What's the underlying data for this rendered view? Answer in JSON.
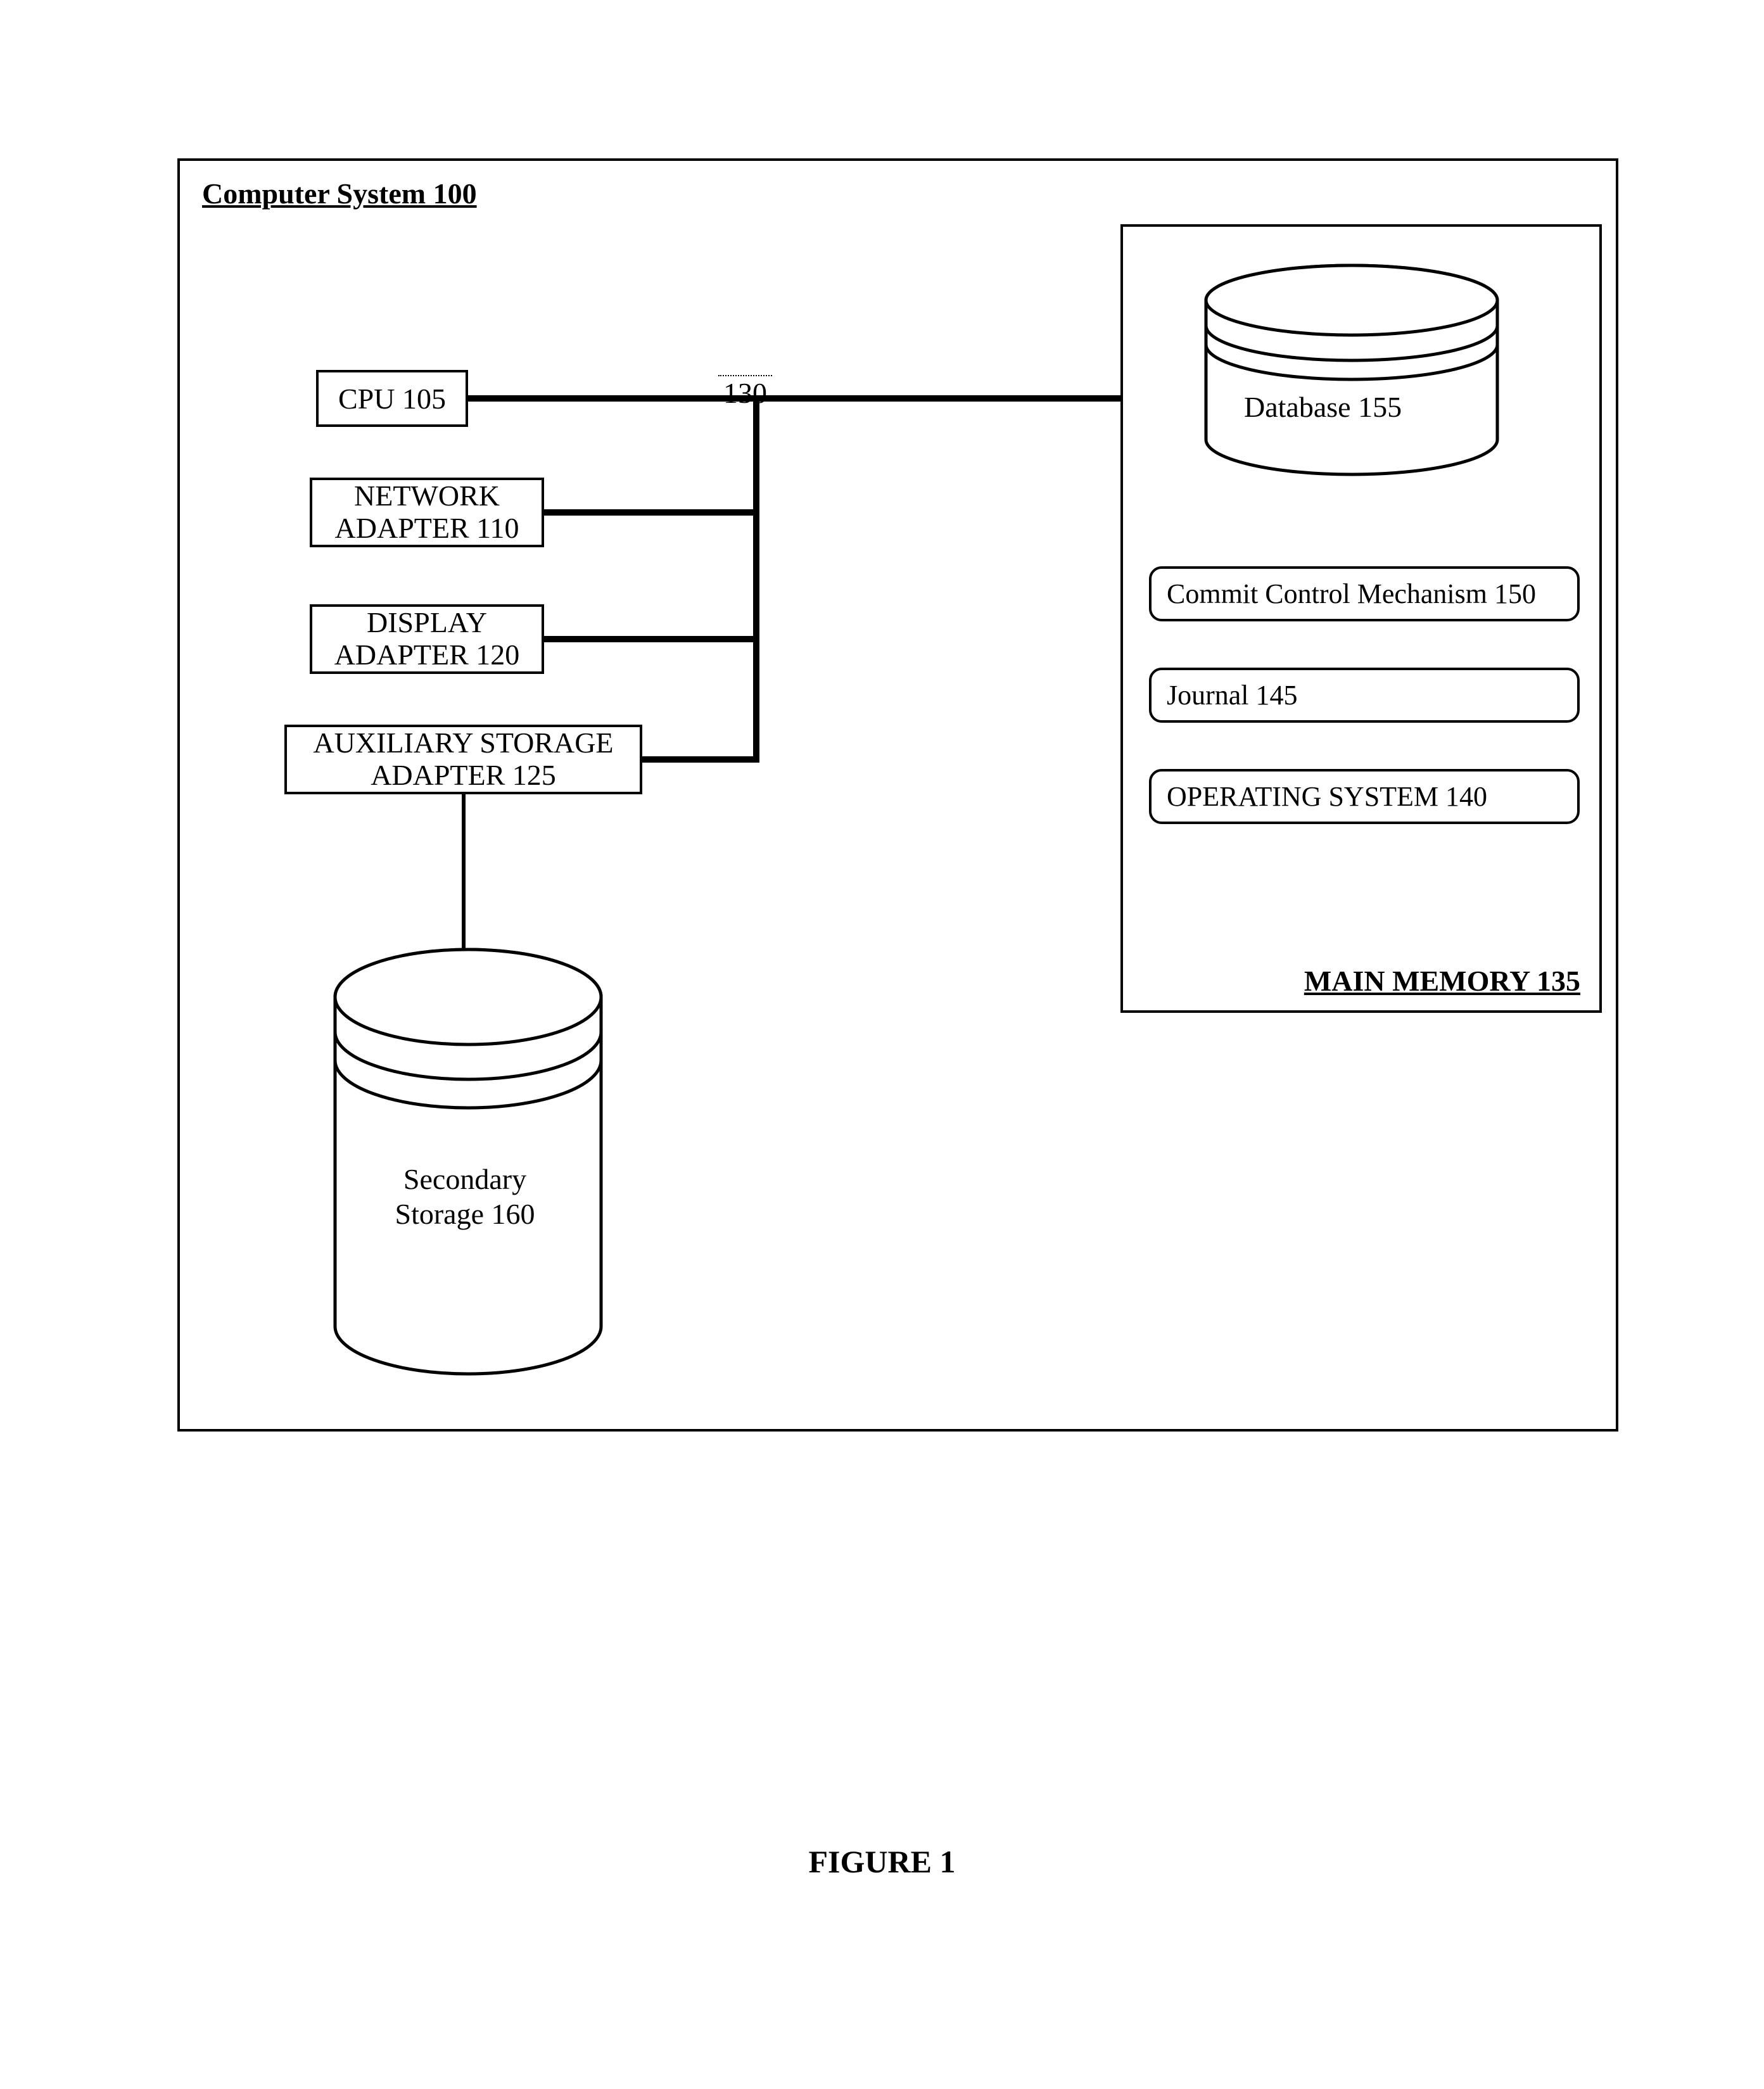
{
  "system_title": "Computer System 100",
  "cpu": "CPU 105",
  "network_adapter_l1": "NETWORK",
  "network_adapter_l2": "ADAPTER 110",
  "display_adapter_l1": "DISPLAY",
  "display_adapter_l2": "ADAPTER 120",
  "aux_adapter_l1": "AUXILIARY STORAGE",
  "aux_adapter_l2": "ADAPTER 125",
  "bus_label": "130",
  "memory_label": "MAIN MEMORY 135",
  "database": "Database 155",
  "commit": "Commit Control Mechanism 150",
  "journal": "Journal 145",
  "os": "OPERATING SYSTEM 140",
  "secondary_l1": "Secondary",
  "secondary_l2": "Storage 160",
  "figure_caption": "FIGURE 1"
}
